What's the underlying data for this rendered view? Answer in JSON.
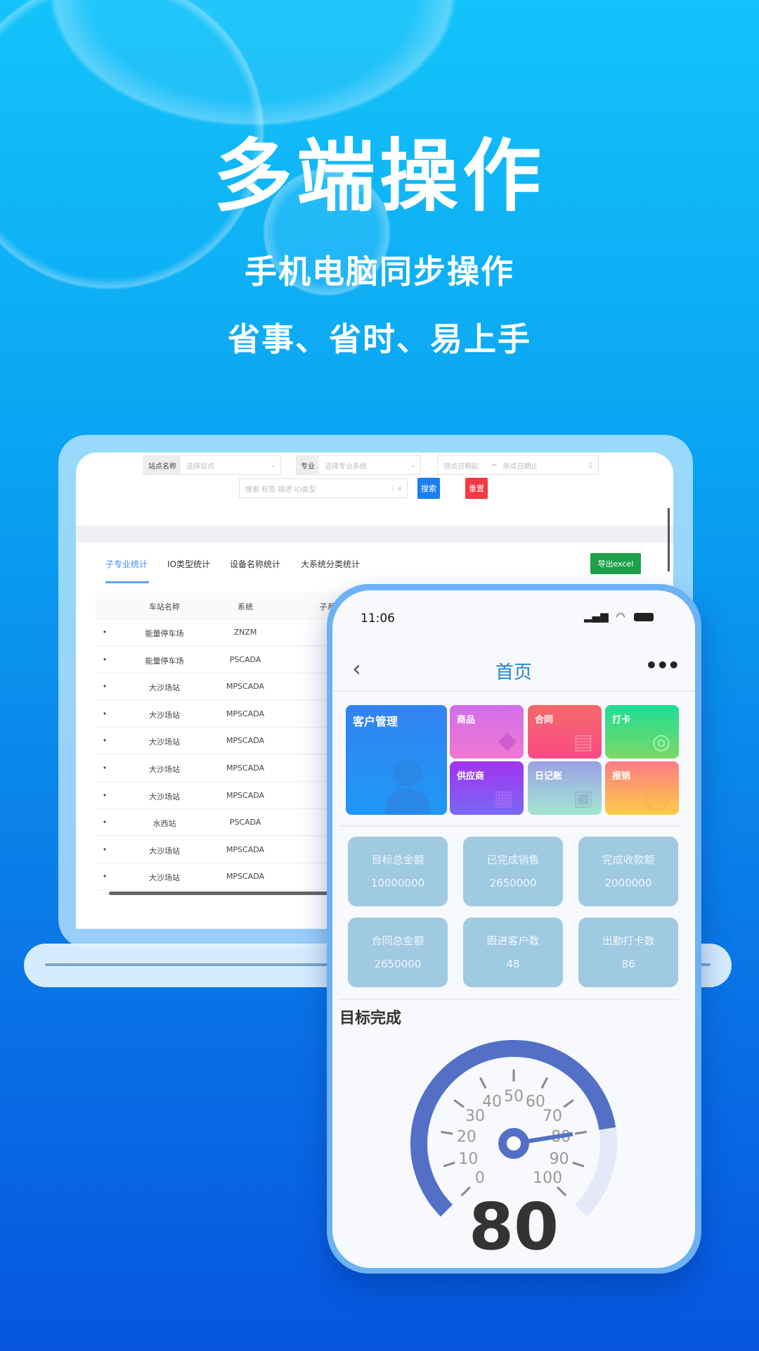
{
  "hero": {
    "title": "多端操作",
    "subtitle": "手机电脑同步操作",
    "tagline": "省事、省时、易上手"
  },
  "desktop": {
    "filters": {
      "station_label": "站点名称",
      "station_placeholder": "选择站点",
      "major_label": "专业",
      "major_placeholder": "选择专业系统",
      "date_start": "测点日期起",
      "date_sep": "~",
      "date_end": "测点日期止",
      "search_placeholder": "搜索 标签 描述 IO类型",
      "search_button": "搜索",
      "reset_button": "重置"
    },
    "tabs": [
      "子专业统计",
      "IO类型统计",
      "设备名称统计",
      "大系统分类统计"
    ],
    "active_tab": 0,
    "export_button": "导出excel",
    "columns": [
      "车站名称",
      "系统",
      "子系统"
    ],
    "rows": [
      [
        "能量停车场",
        "ZNZM"
      ],
      [
        "能量停车场",
        "PSCADA"
      ],
      [
        "大沙场站",
        "MPSCADA"
      ],
      [
        "大沙场站",
        "MPSCADA"
      ],
      [
        "大沙场站",
        "MPSCADA"
      ],
      [
        "大沙场站",
        "MPSCADA"
      ],
      [
        "大沙场站",
        "MPSCADA"
      ],
      [
        "水西站",
        "PSCADA"
      ],
      [
        "大沙场站",
        "MPSCADA"
      ],
      [
        "大沙场站",
        "MPSCADA"
      ]
    ]
  },
  "phone": {
    "time": "11:06",
    "title": "首页",
    "tiles": [
      {
        "label": "客户管理",
        "icon": "person-icon"
      },
      {
        "label": "商品",
        "icon": "box-icon"
      },
      {
        "label": "合同",
        "icon": "document-icon"
      },
      {
        "label": "打卡",
        "icon": "touch-icon"
      },
      {
        "label": "供应商",
        "icon": "building-icon"
      },
      {
        "label": "日记账",
        "icon": "ledger-icon"
      },
      {
        "label": "报销",
        "icon": "coin-icon"
      }
    ],
    "stats": [
      {
        "label": "目标总金额",
        "value": "10000000"
      },
      {
        "label": "已完成销售",
        "value": "2650000"
      },
      {
        "label": "完成收款额",
        "value": "2000000"
      },
      {
        "label": "合同总金额",
        "value": "2650000"
      },
      {
        "label": "跟进客户数",
        "value": "48"
      },
      {
        "label": "出勤打卡数",
        "value": "86"
      }
    ],
    "gauge_title": "目标完成"
  },
  "chart_data": {
    "type": "gauge",
    "min": 0,
    "max": 100,
    "value": 80,
    "value_label": "80",
    "ticks": [
      "0",
      "10",
      "20",
      "30",
      "40",
      "50",
      "60",
      "70",
      "80",
      "90",
      "100"
    ],
    "colors": {
      "progress": "#5470c6",
      "track": "#e3e9f6"
    }
  }
}
